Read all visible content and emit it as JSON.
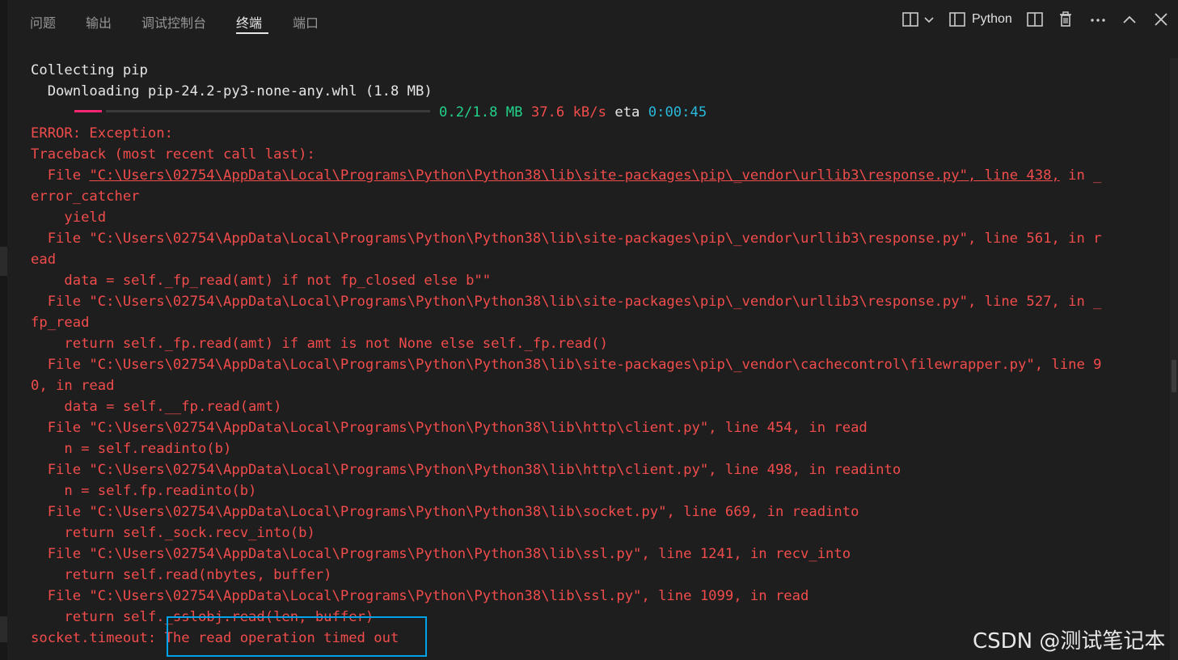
{
  "panel": {
    "tabs": [
      "问题",
      "输出",
      "调试控制台",
      "终端",
      "端口"
    ],
    "active_tab": "终端",
    "terminal_profile": "Python"
  },
  "icons": [
    "split-layout-icon",
    "chevron-down-icon",
    "panel-layout-icon",
    "split-terminal-icon",
    "trash-icon",
    "more-icon",
    "chevron-up-icon",
    "close-icon"
  ],
  "terminal": {
    "collecting": "Collecting pip",
    "downloading": "  Downloading pip-24.2-py3-none-any.whl (1.8 MB)",
    "progress": {
      "done_fraction": 0.11,
      "size": "0.2/1.8 MB",
      "speed": "37.6 kB/s",
      "eta_label": "eta",
      "eta_value": "0:00:45"
    },
    "traceback": [
      "ERROR: Exception:",
      "Traceback (most recent call last):",
      "  File ",
      "\"C:\\Users\\02754\\AppData\\Local\\Programs\\Python\\Python38\\lib\\site-packages\\pip\\_vendor\\urllib3\\response.py\", line 438,",
      " in _",
      "error_catcher",
      "    yield",
      "  File \"C:\\Users\\02754\\AppData\\Local\\Programs\\Python\\Python38\\lib\\site-packages\\pip\\_vendor\\urllib3\\response.py\", line 561, in r",
      "ead",
      "    data = self._fp_read(amt) if not fp_closed else b\"\"",
      "  File \"C:\\Users\\02754\\AppData\\Local\\Programs\\Python\\Python38\\lib\\site-packages\\pip\\_vendor\\urllib3\\response.py\", line 527, in _",
      "fp_read",
      "    return self._fp.read(amt) if amt is not None else self._fp.read()",
      "  File \"C:\\Users\\02754\\AppData\\Local\\Programs\\Python\\Python38\\lib\\site-packages\\pip\\_vendor\\cachecontrol\\filewrapper.py\", line 9",
      "0, in read",
      "    data = self.__fp.read(amt)",
      "  File \"C:\\Users\\02754\\AppData\\Local\\Programs\\Python\\Python38\\lib\\http\\client.py\", line 454, in read",
      "    n = self.readinto(b)",
      "  File \"C:\\Users\\02754\\AppData\\Local\\Programs\\Python\\Python38\\lib\\http\\client.py\", line 498, in readinto",
      "    n = self.fp.readinto(b)",
      "  File \"C:\\Users\\02754\\AppData\\Local\\Programs\\Python\\Python38\\lib\\socket.py\", line 669, in readinto",
      "    return self._sock.recv_into(b)",
      "  File \"C:\\Users\\02754\\AppData\\Local\\Programs\\Python\\Python38\\lib\\ssl.py\", line 1241, in recv_into",
      "    return self.read(nbytes, buffer)",
      "  File \"C:\\Users\\02754\\AppData\\Local\\Programs\\Python\\Python38\\lib\\ssl.py\", line 1099, in read",
      "    return self._sslobj.read(len, buffer)",
      "socket.timeout: The read operation timed out"
    ]
  },
  "watermark": "CSDN @测试笔记本",
  "colors": {
    "background": "#1e1e1e",
    "error_red": "#f14c4c",
    "progress_green": "#23d18b",
    "eta_cyan": "#29b8db",
    "progress_bar": "#f92672",
    "highlight_box": "#00a2e8"
  }
}
